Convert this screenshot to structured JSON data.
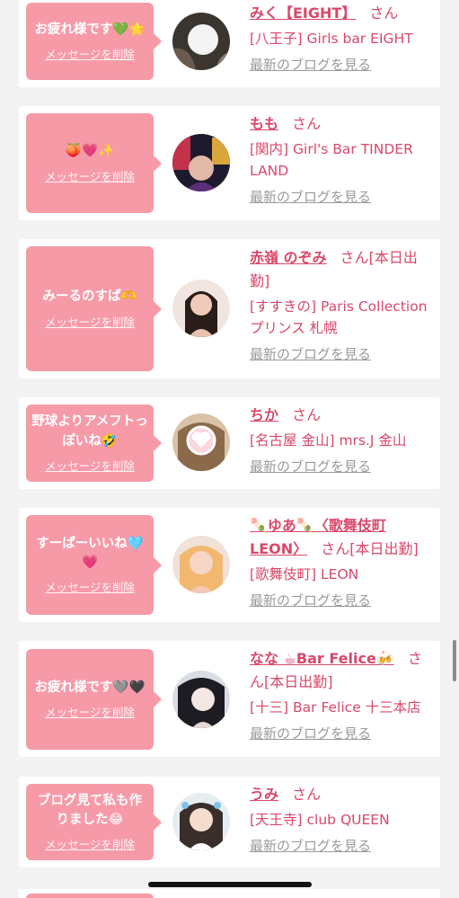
{
  "common": {
    "delete_label": "メッセージを削除",
    "blog_label": "最新のブログを見る",
    "san": "さん"
  },
  "colors": {
    "bubble": "#f79aa8",
    "accent": "#d8486a",
    "muted": "#9a9a9a",
    "background": "#f3f3f3"
  },
  "cards": [
    {
      "message": "お疲れ様です💚🌟",
      "name": "みく【EIGHT】",
      "suffix": "さん",
      "shop": "[八王子] Girls bar EIGHT",
      "avatar_icon": "user-photo"
    },
    {
      "message": "🍑💗✨",
      "name": "もも",
      "suffix": "さん",
      "shop": "[関内] Girl's Bar TINDER LAND",
      "avatar_icon": "user-photo"
    },
    {
      "message": "みーるのすぱ🫶",
      "name": "赤嶺 のぞみ",
      "suffix": "さん[本日出勤]",
      "shop": "[すすきの] Paris Collection プリンス 札幌",
      "avatar_icon": "user-photo"
    },
    {
      "message": "野球よりアメフトっぽいね🤣",
      "name": "ちか",
      "suffix": "さん",
      "shop": "[名古屋 金山] mrs.J 金山",
      "avatar_icon": "user-photo"
    },
    {
      "message": "すーぱーいいね🩵💗",
      "name": "🍡ゆあ🍡〈歌舞伎町LEON〉",
      "suffix": "さん[本日出勤]",
      "shop": "[歌舞伎町] LEON",
      "avatar_icon": "user-photo"
    },
    {
      "message": "お疲れ様です🩶🖤",
      "name": "なな ☕Bar Felice🍻",
      "suffix": "さん[本日出勤]",
      "shop": "[十三] Bar Felice 十三本店",
      "avatar_icon": "user-photo"
    },
    {
      "message": "ブログ見て私も作りました😂",
      "name": "うみ",
      "suffix": "さん",
      "shop": "[天王寺] club QUEEN",
      "avatar_icon": "user-photo"
    }
  ]
}
